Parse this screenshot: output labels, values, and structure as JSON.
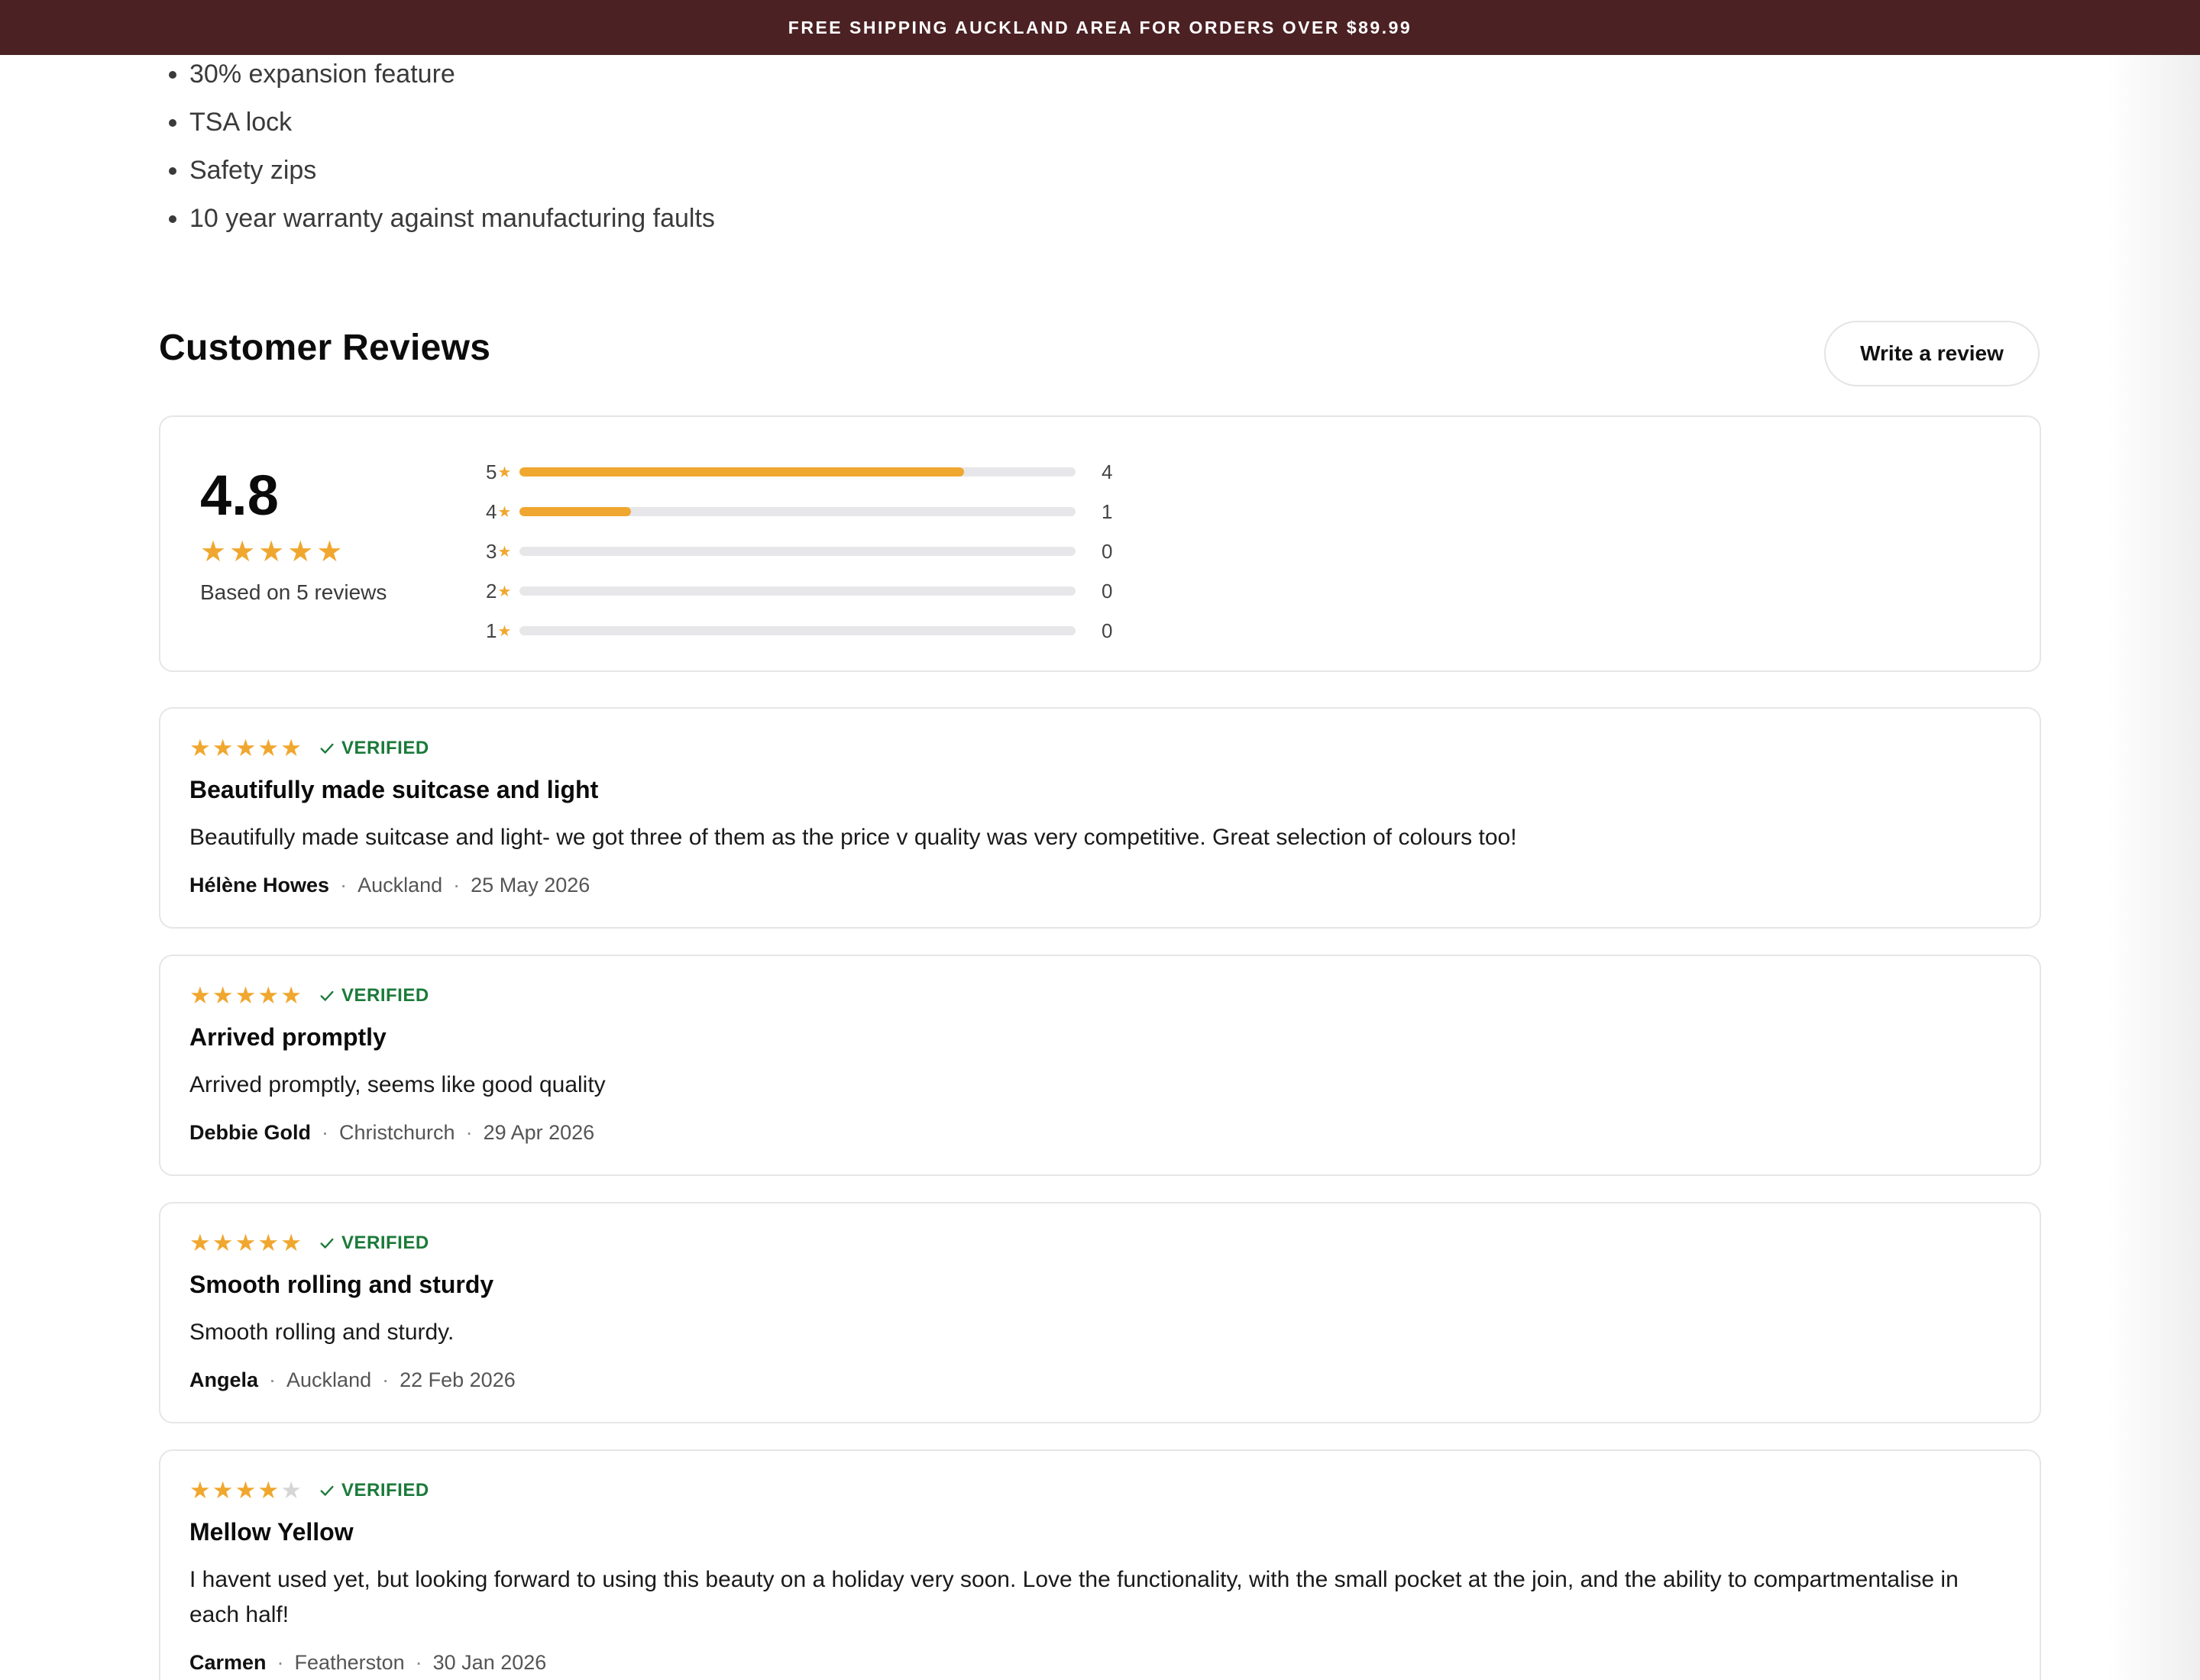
{
  "announcement": "FREE SHIPPING AUCKLAND AREA FOR ORDERS OVER $89.99",
  "features": [
    "30% expansion feature",
    "TSA lock",
    "Safety zips",
    "10 year warranty against manufacturing faults"
  ],
  "reviews_section": {
    "title": "Customer Reviews",
    "write_review_label": "Write a review",
    "average": "4.8",
    "based_on": "Based on 5 reviews",
    "distribution": [
      {
        "label": "5",
        "count": "4",
        "fraction": 0.8
      },
      {
        "label": "4",
        "count": "1",
        "fraction": 0.2
      },
      {
        "label": "3",
        "count": "0",
        "fraction": 0
      },
      {
        "label": "2",
        "count": "0",
        "fraction": 0
      },
      {
        "label": "1",
        "count": "0",
        "fraction": 0
      }
    ]
  },
  "reviews": [
    {
      "rating": 5,
      "verified": "VERIFIED",
      "title": "Beautifully made suitcase and light",
      "body": "Beautifully made suitcase and light- we got three of them as the price v quality was very competitive. Great selection of colours too!",
      "author": "Hélène Howes",
      "location": "Auckland",
      "date": "25 May 2026"
    },
    {
      "rating": 5,
      "verified": "VERIFIED",
      "title": "Arrived promptly",
      "body": "Arrived promptly, seems like good quality",
      "author": "Debbie Gold",
      "location": "Christchurch",
      "date": "29 Apr 2026"
    },
    {
      "rating": 5,
      "verified": "VERIFIED",
      "title": "Smooth rolling and sturdy",
      "body": "Smooth rolling and sturdy.",
      "author": "Angela",
      "location": "Auckland",
      "date": "22 Feb 2026"
    },
    {
      "rating": 4,
      "verified": "VERIFIED",
      "title": "Mellow Yellow",
      "body": "I havent used yet, but looking forward to using this beauty on a holiday very soon. Love the functionality, with the small pocket at the join, and the ability to compartmentalise in each half!",
      "author": "Carmen",
      "location": "Featherston",
      "date": "30 Jan 2026"
    }
  ],
  "colors": {
    "announcement_bg": "#4b2123",
    "star": "#f0a72f",
    "star_empty": "#d6d6d6",
    "verified": "#1b7a3a",
    "bar_track": "#e7e7ea"
  }
}
